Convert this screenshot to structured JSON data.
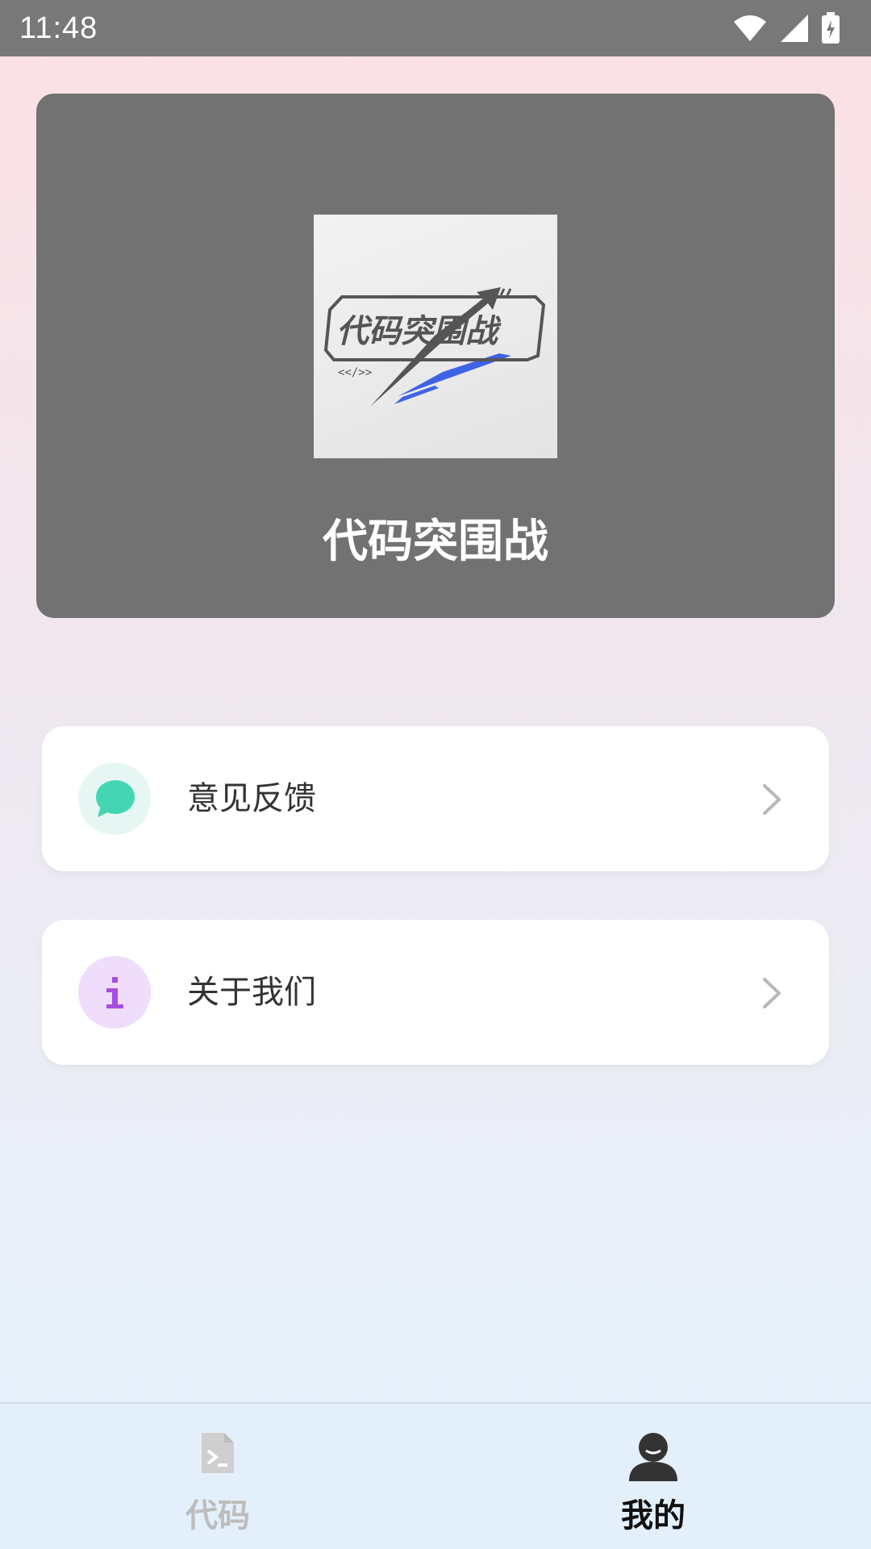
{
  "status_bar": {
    "time": "11:48"
  },
  "app": {
    "name": "代码突围战",
    "logo_text": "代码突围战"
  },
  "menu": [
    {
      "label": "意见反馈",
      "icon": "chat-bubble-icon",
      "icon_color": "#44d6b4",
      "icon_bg": "#e6f7f3"
    },
    {
      "label": "关于我们",
      "icon": "info-icon",
      "icon_color": "#a64de3",
      "icon_bg": "#f0dcfb"
    }
  ],
  "tabs": [
    {
      "label": "代码",
      "icon": "code-file-icon",
      "active": false,
      "color": "#bdbdbd"
    },
    {
      "label": "我的",
      "icon": "person-icon",
      "active": true,
      "color": "#111111"
    }
  ]
}
